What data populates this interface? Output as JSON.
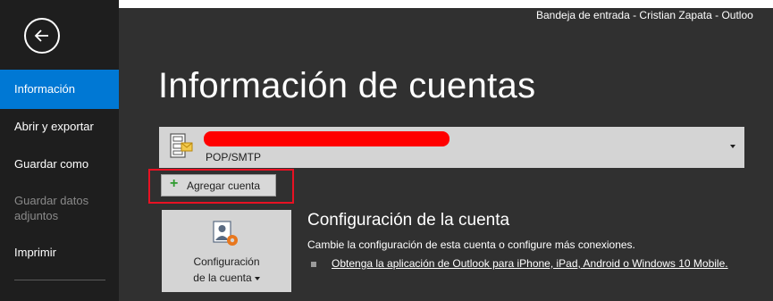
{
  "window": {
    "title": "Bandeja de entrada - Cristian Zapata  -  Outloo"
  },
  "sidebar": {
    "back_icon": "arrow-left-circle-icon",
    "items": [
      {
        "label": "Información",
        "active": true
      },
      {
        "label": "Abrir y exportar"
      },
      {
        "label": "Guardar como"
      },
      {
        "label": "Guardar datos adjuntos",
        "disabled": true
      },
      {
        "label": "Imprimir"
      }
    ]
  },
  "page": {
    "title": "Información de cuentas"
  },
  "account": {
    "type": "POP/SMTP",
    "icon": "mail-account-icon"
  },
  "add_account": {
    "label": "Agregar cuenta",
    "icon": "plus-icon"
  },
  "settings": {
    "tile_label_line1": "Configuración",
    "tile_label_line2": "de la cuenta",
    "icon": "account-settings-icon",
    "title": "Configuración de la cuenta",
    "description": "Cambie la configuración de esta cuenta o configure más conexiones.",
    "link": "Obtenga la aplicación de Outlook para iPhone, iPad, Android o Windows 10 Mobile."
  },
  "colors": {
    "sidebar_bg": "#1e1e1e",
    "main_bg": "#303030",
    "accent": "#0078d4",
    "highlight": "#e81123",
    "redaction": "#ff0000"
  }
}
